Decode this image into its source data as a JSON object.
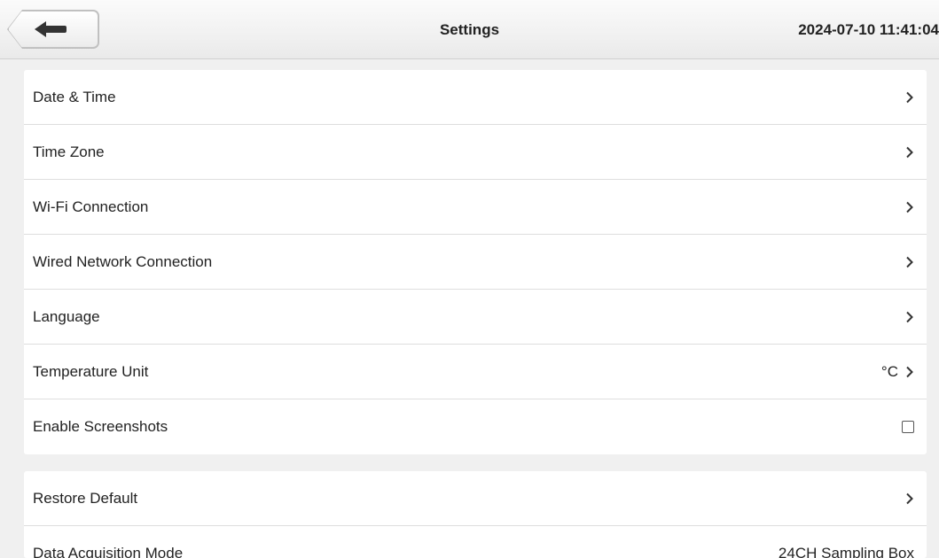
{
  "header": {
    "title": "Settings",
    "datetime": "2024-07-10 11:41:04"
  },
  "icons": {
    "back": "back-arrow-icon",
    "chevron": "chevron-right-icon",
    "checkbox": "checkbox-unchecked-icon"
  },
  "group1": [
    {
      "label": "Date & Time"
    },
    {
      "label": "Time Zone"
    },
    {
      "label": "Wi-Fi Connection"
    },
    {
      "label": "Wired Network Connection"
    },
    {
      "label": "Language"
    },
    {
      "label": "Temperature Unit",
      "value": "°C"
    },
    {
      "label": "Enable Screenshots",
      "checked": false
    }
  ],
  "group2": [
    {
      "label": "Restore Default"
    },
    {
      "label": "Data Acquisition Mode",
      "value": "24CH Sampling Box"
    }
  ]
}
